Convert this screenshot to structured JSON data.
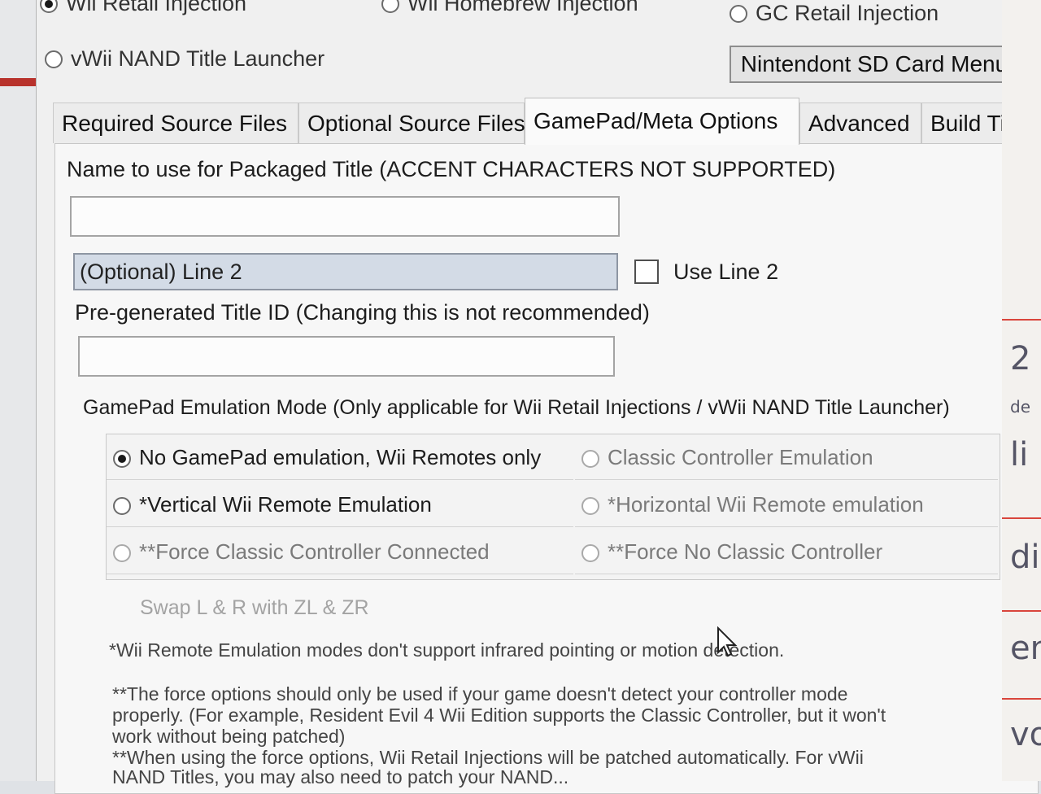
{
  "top_options": {
    "wii_retail": "Wii Retail Injection",
    "wii_homebrew": "Wii Homebrew Injection",
    "gc_retail": "GC Retail Injection",
    "vwii_nand": "vWii NAND Title Launcher"
  },
  "nintendont_button": "Nintendont SD Card Menu",
  "tabs": [
    {
      "label": "Required Source Files"
    },
    {
      "label": "Optional Source Files"
    },
    {
      "label": "GamePad/Meta Options"
    },
    {
      "label": "Advanced"
    },
    {
      "label": "Build Title"
    }
  ],
  "active_tab": "GamePad/Meta Options",
  "meta": {
    "name_label": "Name to use for Packaged Title (ACCENT CHARACTERS NOT SUPPORTED)",
    "name_value": "",
    "line2_value": "(Optional) Line 2",
    "use_line2_label": "Use Line 2",
    "use_line2_checked": false,
    "title_id_label": "Pre-generated Title ID (Changing this is not recommended)",
    "title_id_value": ""
  },
  "gamepad": {
    "group_label": "GamePad Emulation Mode (Only applicable for Wii Retail Injections / vWii NAND Title Launcher)",
    "options": [
      {
        "label": "No GamePad emulation, Wii Remotes only",
        "checked": true
      },
      {
        "label": "Classic Controller Emulation",
        "checked": false
      },
      {
        "label": "*Vertical Wii Remote Emulation",
        "checked": false
      },
      {
        "label": "*Horizontal Wii Remote emulation",
        "checked": false
      },
      {
        "label": "**Force Classic Controller Connected",
        "checked": false
      },
      {
        "label": "**Force No Classic Controller",
        "checked": false
      }
    ],
    "swap_label": "Swap L & R with ZL & ZR"
  },
  "notes": {
    "note1": "*Wii Remote Emulation modes don't support infrared pointing or motion detection.",
    "note2_line1": "**The force options should only be used if your game doesn't detect your controller mode",
    "note2_line2": "properly. (For example, Resident Evil 4 Wii Edition supports the Classic Controller, but it won't",
    "note2_line3": "work without being patched)",
    "note3_line1": "**When using the force options, Wii Retail Injections will be patched automatically. For vWii",
    "note3_line2": "NAND Titles, you may also need to patch your NAND..."
  },
  "background_fragments": [
    "2",
    "de",
    "li",
    "dic",
    "enz",
    "voti"
  ]
}
